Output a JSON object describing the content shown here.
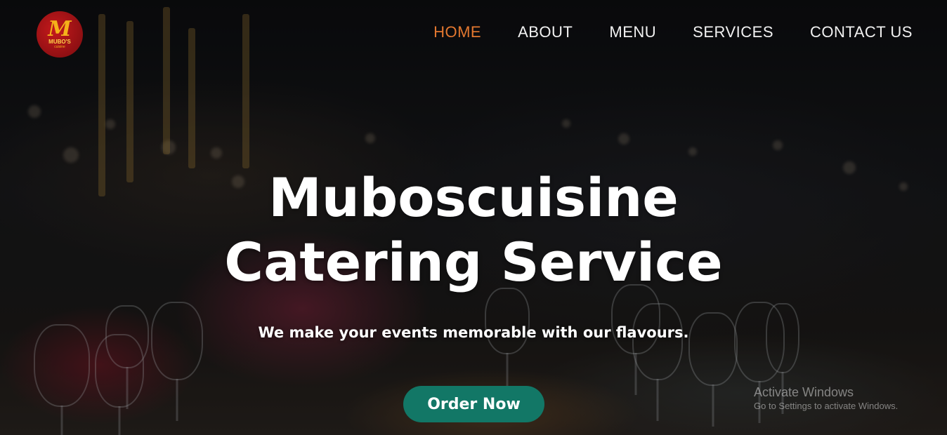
{
  "brand": {
    "logo_letter": "M",
    "logo_name": "MUBO'S",
    "logo_tagline": "cuisine"
  },
  "nav": {
    "items": [
      {
        "label": "HOME",
        "active": true
      },
      {
        "label": "ABOUT",
        "active": false
      },
      {
        "label": "MENU",
        "active": false
      },
      {
        "label": "SERVICES",
        "active": false
      },
      {
        "label": "CONTACT US",
        "active": false
      }
    ]
  },
  "hero": {
    "title": "Muboscuisine Catering Service",
    "subtitle": "We make your events memorable with our flavours.",
    "cta_label": "Order Now"
  },
  "watermark": {
    "title": "Activate Windows",
    "subtitle": "Go to Settings to activate Windows."
  },
  "colors": {
    "accent": "#e2772f",
    "cta": "#127766",
    "logo_red": "#c4191c",
    "logo_gold": "#f5b21a"
  },
  "icons": {
    "logo": "mubos-cuisine-logo"
  }
}
